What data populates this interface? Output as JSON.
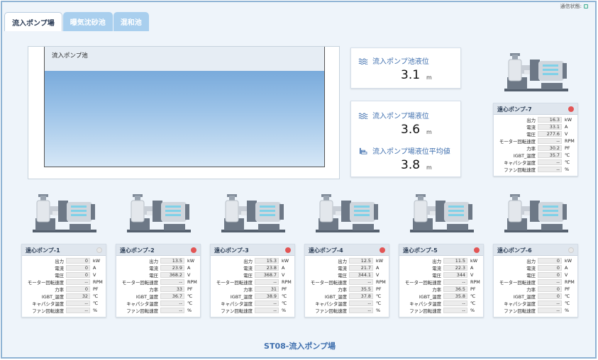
{
  "connection": {
    "label": "通信状態:"
  },
  "tabs": [
    {
      "label": "流入ポンプ場",
      "active": true
    },
    {
      "label": "曝気沈砂池",
      "active": false
    },
    {
      "label": "混和池",
      "active": false
    }
  ],
  "tank": {
    "label": "流入ポンプ池",
    "water_level_fraction": 0.86
  },
  "levels": [
    {
      "title": "流入ポンプ池液位",
      "value": "3.1",
      "unit": "m",
      "icon": "wave-icon"
    },
    {
      "title": "流入ポンプ場液位",
      "value": "3.6",
      "unit": "m",
      "icon": "wave-icon"
    },
    {
      "title": "流入ポンプ場液位平均値",
      "value": "3.8",
      "unit": "m",
      "icon": "level-chart-icon"
    }
  ],
  "row_labels": [
    "出力",
    "電流",
    "電圧",
    "モーター回転速度",
    "力率",
    "IGBT_温度",
    "キャパシタ温度",
    "ファン回転速度"
  ],
  "row_units": [
    "kW",
    "A",
    "V",
    "RPM",
    "PF",
    "℃",
    "℃",
    "%"
  ],
  "pumps": [
    {
      "id": "p1",
      "title": "遠心ポンプ-1",
      "status": "off",
      "values": [
        "0",
        "0",
        "0",
        "--",
        "0",
        "32",
        "--",
        "--"
      ]
    },
    {
      "id": "p2",
      "title": "遠心ポンプ-2",
      "status": "red",
      "values": [
        "13.5",
        "23.9",
        "368.2",
        "--",
        "33",
        "36.7",
        "--",
        "--"
      ]
    },
    {
      "id": "p3",
      "title": "遠心ポンプ-3",
      "status": "red",
      "values": [
        "15.3",
        "23.8",
        "368.7",
        "--",
        "31",
        "38.9",
        "--",
        "--"
      ]
    },
    {
      "id": "p4",
      "title": "遠心ポンプ-4",
      "status": "red",
      "values": [
        "12.5",
        "21.7",
        "344.1",
        "--",
        "35.5",
        "37.8",
        "--",
        "--"
      ]
    },
    {
      "id": "p5",
      "title": "遠心ポンプ-5",
      "status": "red",
      "values": [
        "11.5",
        "22.3",
        "344",
        "--",
        "36.5",
        "35.8",
        "--",
        "--"
      ]
    },
    {
      "id": "p6",
      "title": "遠心ポンプ-6",
      "status": "off",
      "values": [
        "0",
        "0",
        "0",
        "--",
        "0",
        "0",
        "--",
        "--"
      ]
    },
    {
      "id": "p7",
      "title": "遠心ポンプ-7",
      "status": "red",
      "values": [
        "16.3",
        "33.1",
        "277.6",
        "--",
        "30.2",
        "35.7",
        "--",
        "--"
      ]
    }
  ],
  "station_title": "ST08-流入ポンプ場",
  "colors": {
    "accent": "#3f6fae",
    "alarm": "#e25555",
    "tab_inactive": "#a9cfee"
  }
}
